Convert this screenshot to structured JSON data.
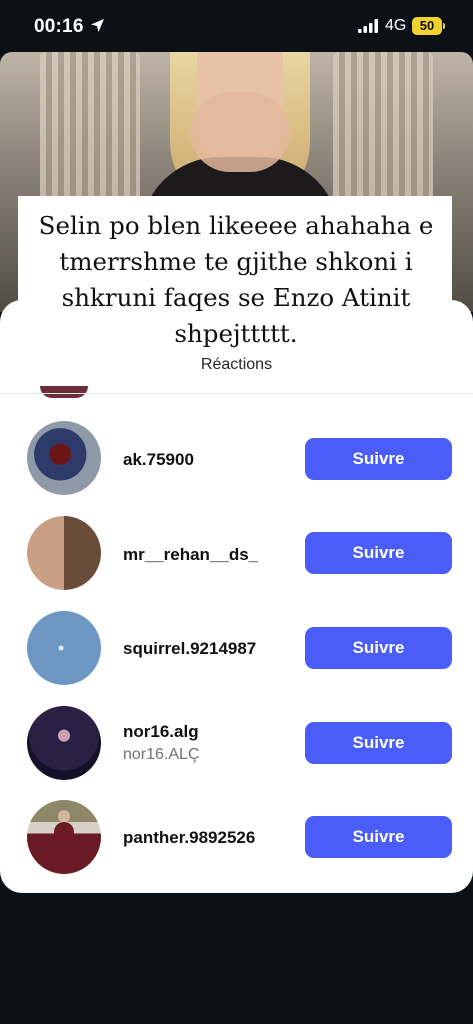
{
  "status_bar": {
    "time": "00:16",
    "network": "4G",
    "battery": "50"
  },
  "story": {
    "caption": "Selin po blen likeeee ahahaha e tmerrshme te gjithe shkoni i shkruni faqes se Enzo Atinit shpejttttt."
  },
  "sheet": {
    "title": "Réactions",
    "rows": [
      {
        "username": "ak.75900",
        "subname": "",
        "button": "Suivre"
      },
      {
        "username": "mr__rehan__ds_",
        "subname": "",
        "button": "Suivre"
      },
      {
        "username": "squirrel.9214987",
        "subname": "",
        "button": "Suivre"
      },
      {
        "username": "nor16.alg",
        "subname": "nor16.ALÇ",
        "button": "Suivre"
      },
      {
        "username": "panther.9892526",
        "subname": "",
        "button": "Suivre"
      }
    ]
  },
  "colors": {
    "accent": "#4a5df9",
    "background": "#0c1117",
    "battery": "#f2d230"
  },
  "icons": [
    "location-arrow-icon",
    "signal-bars-icon"
  ]
}
